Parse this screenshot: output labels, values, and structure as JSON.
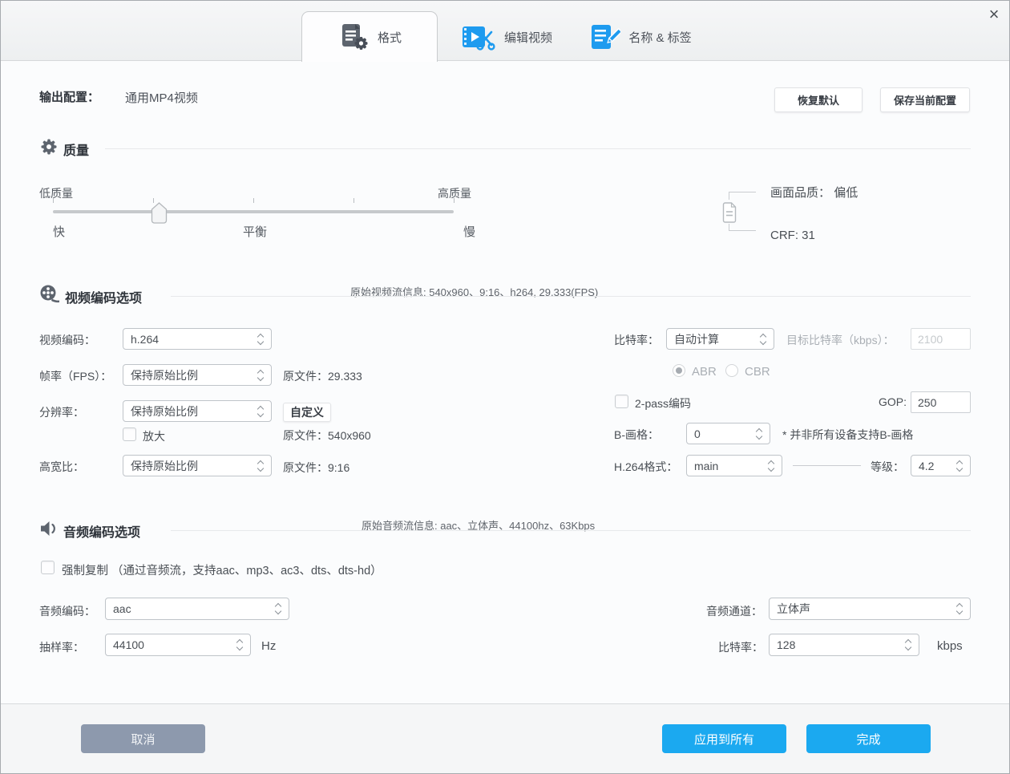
{
  "window": {
    "close_icon": "×"
  },
  "icons": {
    "close-icon": "×",
    "format-tab-icon": "document-with-gear (svg, gray)",
    "edit-video-tab-icon": "film-with-scissors (svg, blue)",
    "name-tag-tab-icon": "document-with-pencil (svg, blue)",
    "quality-gear-icon": "gear (svg, dark gray)",
    "video-reel-icon": "film-reel (svg, dark gray)",
    "audio-speaker-icon": "speaker (svg, dark gray)",
    "crf-file-icon": "document-outline (svg, light gray)",
    "dropdown-arrows-icon": "up-down chevrons (css)"
  },
  "colors": {
    "accent_blue": "#1ba9f0",
    "cancel_gray": "#8d99ad",
    "text_dark": "#30353c",
    "text_normal": "#4a4f55",
    "disabled": "#aaafb5"
  },
  "tabs": [
    {
      "label": "格式",
      "active": true
    },
    {
      "label": "编辑视频",
      "active": false
    },
    {
      "label": "名称 & 标签",
      "active": false
    }
  ],
  "output_config": {
    "label": "输出配置：",
    "value": "通用MP4视频",
    "restore_default": "恢复默认",
    "save_current": "保存当前配置"
  },
  "quality": {
    "title": "质量",
    "slider": {
      "left_top": "低质量",
      "right_top": "高质量",
      "left_bottom": "快",
      "center_bottom": "平衡",
      "right_bottom": "慢",
      "position_percent": 26
    },
    "picture_quality_label": "画面品质：",
    "picture_quality_value": "偏低",
    "crf_label": "CRF:",
    "crf_value": "31"
  },
  "video": {
    "title": "视频编码选项",
    "stream_info": "原始视频流信息: 540x960、9:16、h264, 29.333(FPS)",
    "codec_label": "视频编码：",
    "codec_value": "h.264",
    "fps_label": "帧率（FPS）：",
    "fps_value": "保持原始比例",
    "fps_original": "原文件：29.333",
    "resolution_label": "分辨率：",
    "resolution_value": "保持原始比例",
    "custom_button": "自定义",
    "upscale_label": "放大",
    "resolution_original": "原文件：540x960",
    "aspect_label": "高宽比：",
    "aspect_value": "保持原始比例",
    "aspect_original": "原文件：9:16",
    "bitrate_label": "比特率：",
    "bitrate_value": "自动计算",
    "target_bitrate_label": "目标比特率（kbps）：",
    "target_bitrate_value": "2100",
    "abr_label": "ABR",
    "cbr_label": "CBR",
    "twopass_label": "2-pass编码",
    "gop_label": "GOP:",
    "gop_value": "250",
    "bframe_label": "B-画格：",
    "bframe_value": "0",
    "bframe_note": "* 并非所有设备支持B-画格",
    "h264_label": "H.264格式：",
    "h264_value": "main",
    "level_label": "等级：",
    "level_value": "4.2"
  },
  "audio": {
    "title": "音频编码选项",
    "stream_info": "原始音频流信息: aac、立体声、44100hz、63Kbps",
    "force_copy_label": "强制复制 （通过音频流，支持aac、mp3、ac3、dts、dts-hd）",
    "codec_label": "音频编码：",
    "codec_value": "aac",
    "channel_label": "音频通道：",
    "channel_value": "立体声",
    "sample_label": "抽样率：",
    "sample_value": "44100",
    "sample_unit": "Hz",
    "bitrate_label": "比特率：",
    "bitrate_value": "128",
    "bitrate_unit": "kbps"
  },
  "footer": {
    "cancel": "取消",
    "apply_all": "应用到所有",
    "done": "完成"
  }
}
